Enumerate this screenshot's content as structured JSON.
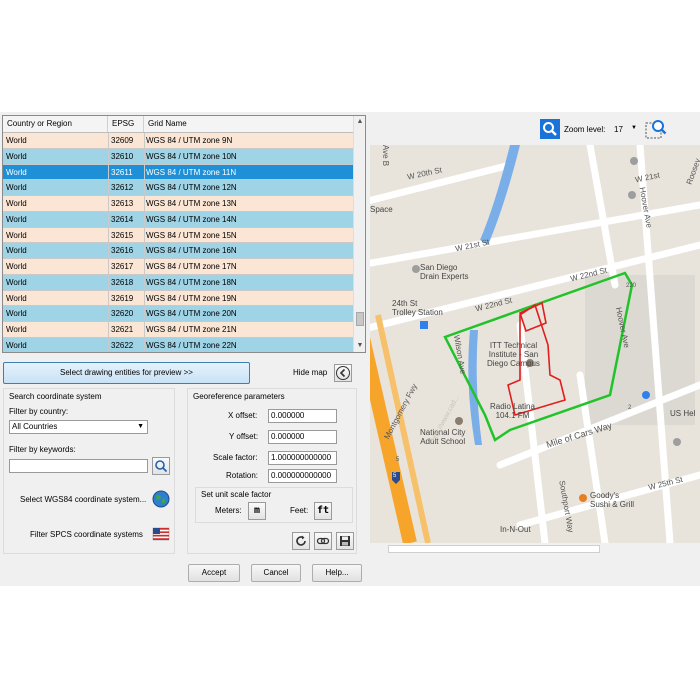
{
  "grid": {
    "headers": [
      "Country or Region",
      "EPSG",
      "Grid Name"
    ],
    "rows": [
      {
        "country": "World",
        "epsg": "32609",
        "name": "WGS 84 / UTM zone 9N"
      },
      {
        "country": "World",
        "epsg": "32610",
        "name": "WGS 84 / UTM zone 10N"
      },
      {
        "country": "World",
        "epsg": "32611",
        "name": "WGS 84 / UTM zone 11N"
      },
      {
        "country": "World",
        "epsg": "32612",
        "name": "WGS 84 / UTM zone 12N"
      },
      {
        "country": "World",
        "epsg": "32613",
        "name": "WGS 84 / UTM zone 13N"
      },
      {
        "country": "World",
        "epsg": "32614",
        "name": "WGS 84 / UTM zone 14N"
      },
      {
        "country": "World",
        "epsg": "32615",
        "name": "WGS 84 / UTM zone 15N"
      },
      {
        "country": "World",
        "epsg": "32616",
        "name": "WGS 84 / UTM zone 16N"
      },
      {
        "country": "World",
        "epsg": "32617",
        "name": "WGS 84 / UTM zone 17N"
      },
      {
        "country": "World",
        "epsg": "32618",
        "name": "WGS 84 / UTM zone 18N"
      },
      {
        "country": "World",
        "epsg": "32619",
        "name": "WGS 84 / UTM zone 19N"
      },
      {
        "country": "World",
        "epsg": "32620",
        "name": "WGS 84 / UTM zone 20N"
      },
      {
        "country": "World",
        "epsg": "32621",
        "name": "WGS 84 / UTM zone 21N"
      },
      {
        "country": "World",
        "epsg": "32622",
        "name": "WGS 84 / UTM zone 22N"
      }
    ],
    "selected_index": 2
  },
  "preview_button": "Select drawing entities for preview >>",
  "hide_map": "Hide map",
  "search": {
    "title": "Search coordinate system",
    "filter_country_label": "Filter by country:",
    "country_value": "All Countries",
    "filter_keywords_label": "Filter by keywords:",
    "keywords_value": "",
    "wgs84_label": "Select WGS84 coordinate system...",
    "spcs_label": "Filter SPCS coordinate systems"
  },
  "georef": {
    "title": "Georeference parameters",
    "x_label": "X offset:",
    "x_value": "0.000000",
    "y_label": "Y offset:",
    "y_value": "0.000000",
    "scale_label": "Scale factor:",
    "scale_value": "1.000000000000",
    "rotation_label": "Rotation:",
    "rotation_value": "0.000000000000",
    "unit_title": "Set unit scale factor",
    "meters_label": "Meters:",
    "meters_button": "m",
    "feet_label": "Feet:",
    "feet_button": "ft"
  },
  "dialog_buttons": {
    "accept": "Accept",
    "cancel": "Cancel",
    "help": "Help..."
  },
  "map": {
    "zoom_label": "Zoom level:",
    "zoom_value": "17",
    "labels": {
      "w20th": "W 20th St",
      "w21st_a": "W 21st St",
      "w21st_b": "W 21st",
      "w22nd_a": "W 22nd St",
      "w22nd_b": "W 22nd St",
      "roosevelt": "Roosev",
      "hoover1": "Hoover Ave",
      "hoover2": "Hoover Ave",
      "ave_b": "Ave B",
      "space": "Space",
      "drain": "San Diego\nDrain Experts",
      "th24": "24th St\nTrolley Station",
      "wilson": "Wilson Ave",
      "itt": "ITT Technical\nInstitute - San\nDiego Campus",
      "radio": "Radio Latina\n104.1 FM",
      "national": "National City\nAdult School",
      "mile": "Mile of Cars Way",
      "monty": "Montgomery Fwy",
      "goodys": "Goody's\nSushi & Grill",
      "innout": "In-N-Out",
      "w25th": "W 25th St",
      "ushe": "US Hel",
      "highway": "5",
      "highway2": "5",
      "rd220": "220",
      "rd2": "2",
      "southport": "Southport Way",
      "watermark": "http://www.cad..."
    },
    "colors": {
      "boundary": "#22c32a",
      "drawing": "#e11d1d",
      "water": "#7aaee8",
      "highway": "#f6a52a"
    }
  }
}
